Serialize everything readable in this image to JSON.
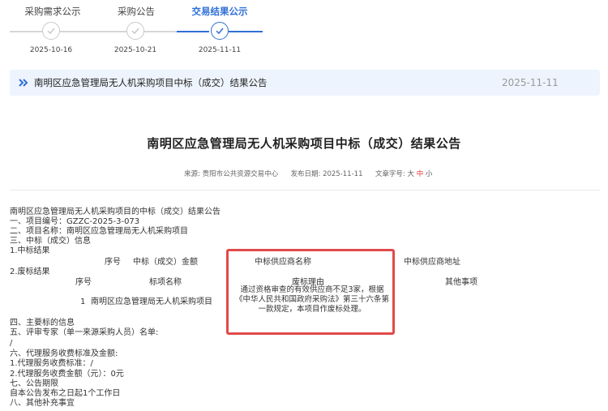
{
  "stepper": {
    "steps": [
      {
        "label": "采购需求公示",
        "date": "2025-10-16",
        "active": false
      },
      {
        "label": "采购公告",
        "date": "2025-10-21",
        "active": false
      },
      {
        "label": "交易结果公示",
        "date": "2025-11-11",
        "active": true
      }
    ]
  },
  "notice": {
    "title": "南明区应急管理局无人机采购项目中标（成交）结果公告",
    "date": "2025-11-11"
  },
  "article": {
    "title": "南明区应急管理局无人机采购项目中标（成交）结果公告",
    "meta": {
      "source_label": "来源:",
      "source": "贵阳市公共资源交易中心",
      "date_label": "发布日期:",
      "date": "2025-11-11",
      "font_label": "文章字号:",
      "size_large": "大",
      "size_medium": "中",
      "size_small": "小"
    },
    "lines": {
      "intro": "南明区应急管理局无人机采购项目的中标（成交）结果公告",
      "item1": "一、项目编号：GZZC-2025-3-073",
      "item2": "二、项目名称：南明区应急管理局无人机采购项目",
      "item3": "三、中标（成交）信息",
      "result_label": "1.中标结果",
      "discard_label": "2.废标结果",
      "item4": "四、主要标的信息",
      "item5": "五、评审专家（单一来源采购人员）名单:",
      "slash1": "/",
      "item6": "六、代理服务收费标准及金额:",
      "fee_std": "1.代理服务收费标准：/",
      "fee_amt": "2.代理服务收费金额（元）：0元",
      "item7": "七、公告期限",
      "period": "自本公告发布之日起1个工作日",
      "item8": "八、其他补充事宜"
    },
    "win_table": {
      "headers": [
        "序号",
        "中标（成交）金额",
        "中标供应商名称",
        "中标供应商地址"
      ]
    },
    "discard_table": {
      "headers": [
        "序号",
        "标项名称",
        "废标理由",
        "其他事项"
      ],
      "row": {
        "index": "1",
        "name": "南明区应急管理局无人机采购项目",
        "reason": "通过资格审查的有效供应商不足3家，根据《中华人民共和国政府采购法》第三十六条第一款规定，本项目作废标处理。"
      }
    }
  },
  "colors": {
    "accent": "#2f6fd6",
    "highlight_box": "#e24a4a",
    "notice_bg": "#eef4fd"
  }
}
